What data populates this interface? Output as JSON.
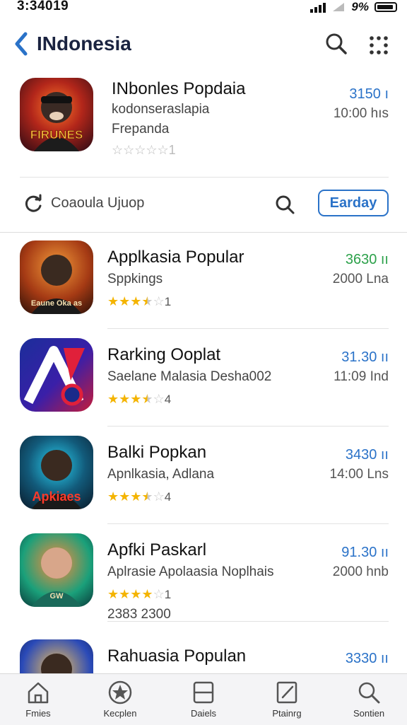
{
  "status": {
    "time": "3:34019",
    "battery_text": "9%"
  },
  "nav": {
    "title": "INdonesia"
  },
  "featured": {
    "name": "INbonles Popdaia",
    "sub1": "kodonseraslapia",
    "sub2": "Frepanda",
    "price": "3150 ı",
    "time": "10:00 hıs",
    "rating_value": 0,
    "rating_label": "☆☆☆☆☆1",
    "icon_text": "FIRUNES"
  },
  "filter": {
    "label": "Coaoula Ujuop",
    "button_label": "Earday"
  },
  "apps": [
    {
      "name": "Applkasia Popular",
      "sub": "Sppkings",
      "price": "3630 ıı",
      "price_color": "#2ca14a",
      "time": "2000 Lna",
      "stars": 3.5,
      "rating_num": "1",
      "icon_text": "Eaune Oka as"
    },
    {
      "name": "Rarking Ooplat",
      "sub": "Saelane Malasia Desha002",
      "price": "31.30 ıı",
      "price_color": "#2a72c8",
      "time": "11:09 Ind",
      "stars": 3.5,
      "rating_num": "4",
      "icon_text": "A"
    },
    {
      "name": "Balki Popkan",
      "sub": "Apnlkasia, Adlana",
      "price": "3430 ıı",
      "price_color": "#2a72c8",
      "time": "14:00 Lns",
      "stars": 3.5,
      "rating_num": "4",
      "icon_text": "Apkiaes"
    },
    {
      "name": "Apfki Paskarl",
      "sub": "Aplrasie Apolaasia Noplhais",
      "price": "91.30 ıı",
      "price_color": "#2a72c8",
      "time": "2000 hnb",
      "stars": 4,
      "rating_num": "1",
      "extra": "2383 2300",
      "icon_text": "GW"
    },
    {
      "name": "Rahuasia Populan",
      "sub": "",
      "price": "3330 ıı",
      "price_color": "#2a72c8",
      "time": "",
      "stars": 0,
      "rating_num": "",
      "icon_text": ""
    }
  ],
  "tabs": [
    {
      "label": "Fmies",
      "icon": "home-icon"
    },
    {
      "label": "Kecplen",
      "icon": "star-icon"
    },
    {
      "label": "Daiels",
      "icon": "layers-icon"
    },
    {
      "label": "Ptainrg",
      "icon": "edit-icon"
    },
    {
      "label": "Sontien",
      "icon": "search-icon"
    }
  ],
  "colors": {
    "accent": "#2a72c8",
    "green": "#2ca14a",
    "star": "#f4b400"
  }
}
